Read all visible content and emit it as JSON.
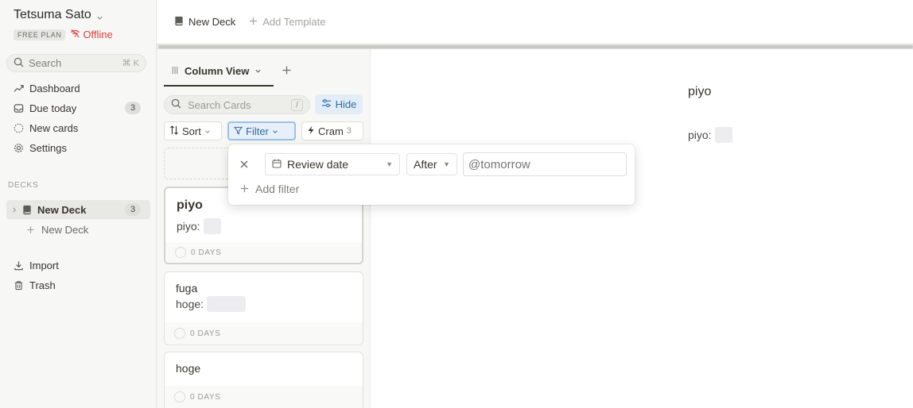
{
  "user": {
    "name": "Tetsuma Sato",
    "plan": "FREE PLAN",
    "status": "Offline"
  },
  "sidebar": {
    "search": {
      "label": "Search",
      "shortcut": "⌘ K"
    },
    "nav": [
      {
        "label": "Dashboard",
        "icon": "trend-icon"
      },
      {
        "label": "Due today",
        "icon": "inbox-icon",
        "count": "3"
      },
      {
        "label": "New cards",
        "icon": "dashed-circle-icon"
      },
      {
        "label": "Settings",
        "icon": "gear-icon"
      }
    ],
    "decks_heading": "DECKS",
    "decks": [
      {
        "label": "New Deck",
        "count": "3",
        "active": true
      }
    ],
    "new_deck_label": "New Deck",
    "bottom": [
      {
        "label": "Import",
        "icon": "download-icon"
      },
      {
        "label": "Trash",
        "icon": "trash-icon"
      }
    ]
  },
  "topbar": {
    "deck_label": "New Deck",
    "add_template_label": "Add Template"
  },
  "column": {
    "view_label": "Column View",
    "search_placeholder": "Search Cards",
    "search_shortcut": "/",
    "hide_label": "Hide",
    "sort_label": "Sort",
    "filter_label": "Filter",
    "cram_label": "Cram",
    "cram_count": "3"
  },
  "cards": [
    {
      "title": "piyo",
      "field_label": "piyo:",
      "footer": "0 DAYS"
    },
    {
      "title": "fuga",
      "field_label": "hoge:",
      "footer": "0 DAYS"
    },
    {
      "title": "hoge",
      "footer": "0 DAYS"
    }
  ],
  "preview": {
    "title": "piyo",
    "field_label": "piyo:"
  },
  "filter_popover": {
    "field": "Review date",
    "operator": "After",
    "value_placeholder": "@tomorrow",
    "add_filter_label": "Add filter"
  },
  "colors": {
    "accent": "#2f6ca8",
    "offline": "#e03e3e",
    "sidebar_bg": "#f7f7f5"
  }
}
